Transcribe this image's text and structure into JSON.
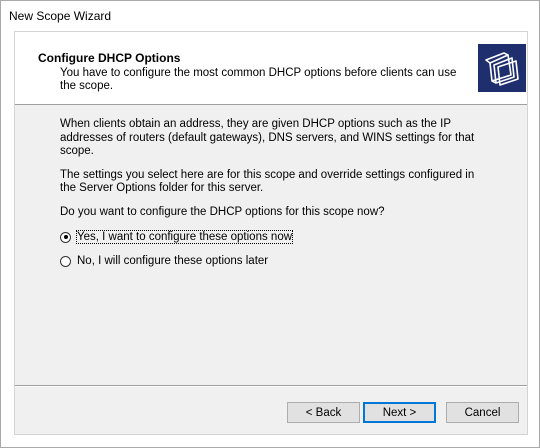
{
  "window": {
    "title": "New Scope Wizard"
  },
  "header": {
    "title": "Configure DHCP Options",
    "subtitle": "You have to configure the most common DHCP options before clients can use the scope.",
    "icon": "wizard-pages-icon"
  },
  "body": {
    "paragraph1": "When clients obtain an address, they are given DHCP options such as the IP addresses of routers (default gateways), DNS servers, and WINS settings for that scope.",
    "paragraph2": "The settings you select here are for this scope and override settings configured in the Server Options folder for this server.",
    "question": "Do you want to configure the DHCP options for this scope now?"
  },
  "options": [
    {
      "label": "Yes, I want to configure these options now",
      "selected": true
    },
    {
      "label": "No, I will configure these options later",
      "selected": false
    }
  ],
  "buttons": {
    "back": "< Back",
    "next": "Next >",
    "cancel": "Cancel"
  },
  "colors": {
    "dialog_bg": "#f0f0f0",
    "header_bg": "#ffffff",
    "icon_bg": "#1f2f6e",
    "default_button_border": "#0078d7"
  }
}
